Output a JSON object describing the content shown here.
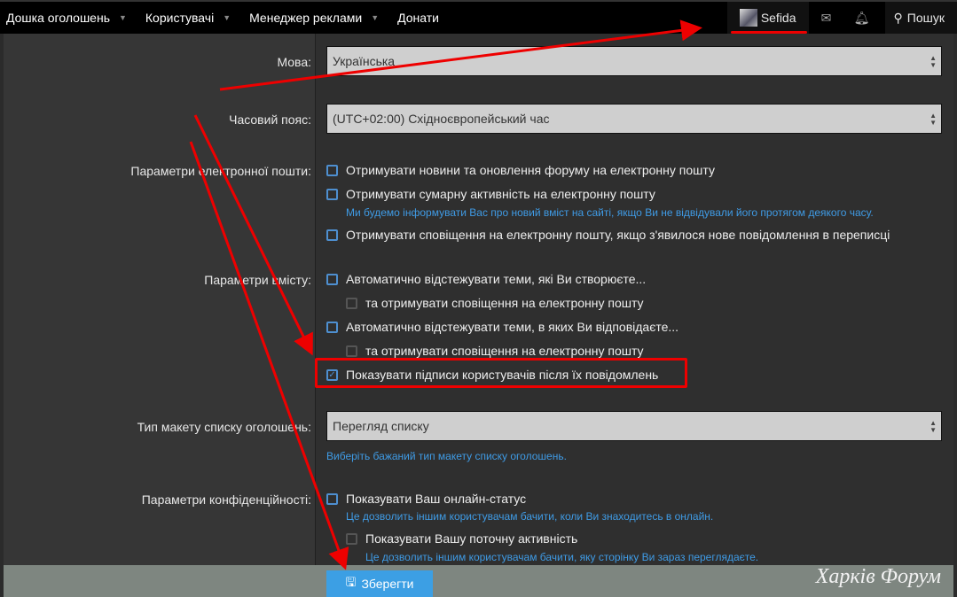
{
  "nav": {
    "items": [
      {
        "label": "Дошка оголошень",
        "caret": true
      },
      {
        "label": "Користувачі",
        "caret": true
      },
      {
        "label": "Менеджер реклами",
        "caret": true
      },
      {
        "label": "Донати",
        "caret": false
      }
    ],
    "username": "Sefida",
    "search": "Пошук"
  },
  "form": {
    "language": {
      "label": "Мова:",
      "value": "Українська"
    },
    "timezone": {
      "label": "Часовий пояс:",
      "value": "(UTC+02:00) Східноєвропейський час"
    },
    "email": {
      "label": "Параметри електронної пошти:",
      "options": [
        {
          "label": "Отримувати новини та оновлення форуму на електронну пошту",
          "checked": false
        },
        {
          "label": "Отримувати сумарну активність на електронну пошту",
          "checked": false,
          "hint": "Ми будемо інформувати Вас про новий вміст на сайті, якщо Ви не відвідували його протягом деякого часу."
        },
        {
          "label": "Отримувати сповіщення на електронну пошту, якщо з'явилося нове повідомлення в переписці",
          "checked": false
        }
      ]
    },
    "content": {
      "label": "Параметри вмісту:",
      "options": [
        {
          "label": "Автоматично відстежувати теми, які Ви створюєте...",
          "checked": false
        },
        {
          "label": "та отримувати сповіщення на електронну пошту",
          "checked": false
        },
        {
          "label": "Автоматично відстежувати теми, в яких Ви відповідаєте...",
          "checked": false
        },
        {
          "label": "та отримувати сповіщення на електронну пошту",
          "checked": false
        },
        {
          "label": "Показувати підписи користувачів після їх повідомлень",
          "checked": true
        }
      ]
    },
    "layout": {
      "label": "Тип макету списку оголошень:",
      "value": "Перегляд списку",
      "hint": "Виберіть бажаний тип макету списку оголошень."
    },
    "privacy": {
      "label": "Параметри конфіденційності:",
      "options": [
        {
          "label": "Показувати Ваш онлайн-статус",
          "checked": false,
          "hint": "Це дозволить іншим користувачам бачити, коли Ви знаходитесь в онлайн."
        },
        {
          "label": "Показувати Вашу поточну активність",
          "checked": false,
          "hint": "Це дозволить іншим користувачам бачити, яку сторінку Ви зараз переглядаєте."
        }
      ]
    }
  },
  "footer": {
    "save": "Зберегти",
    "watermark": "Харків Форум"
  }
}
